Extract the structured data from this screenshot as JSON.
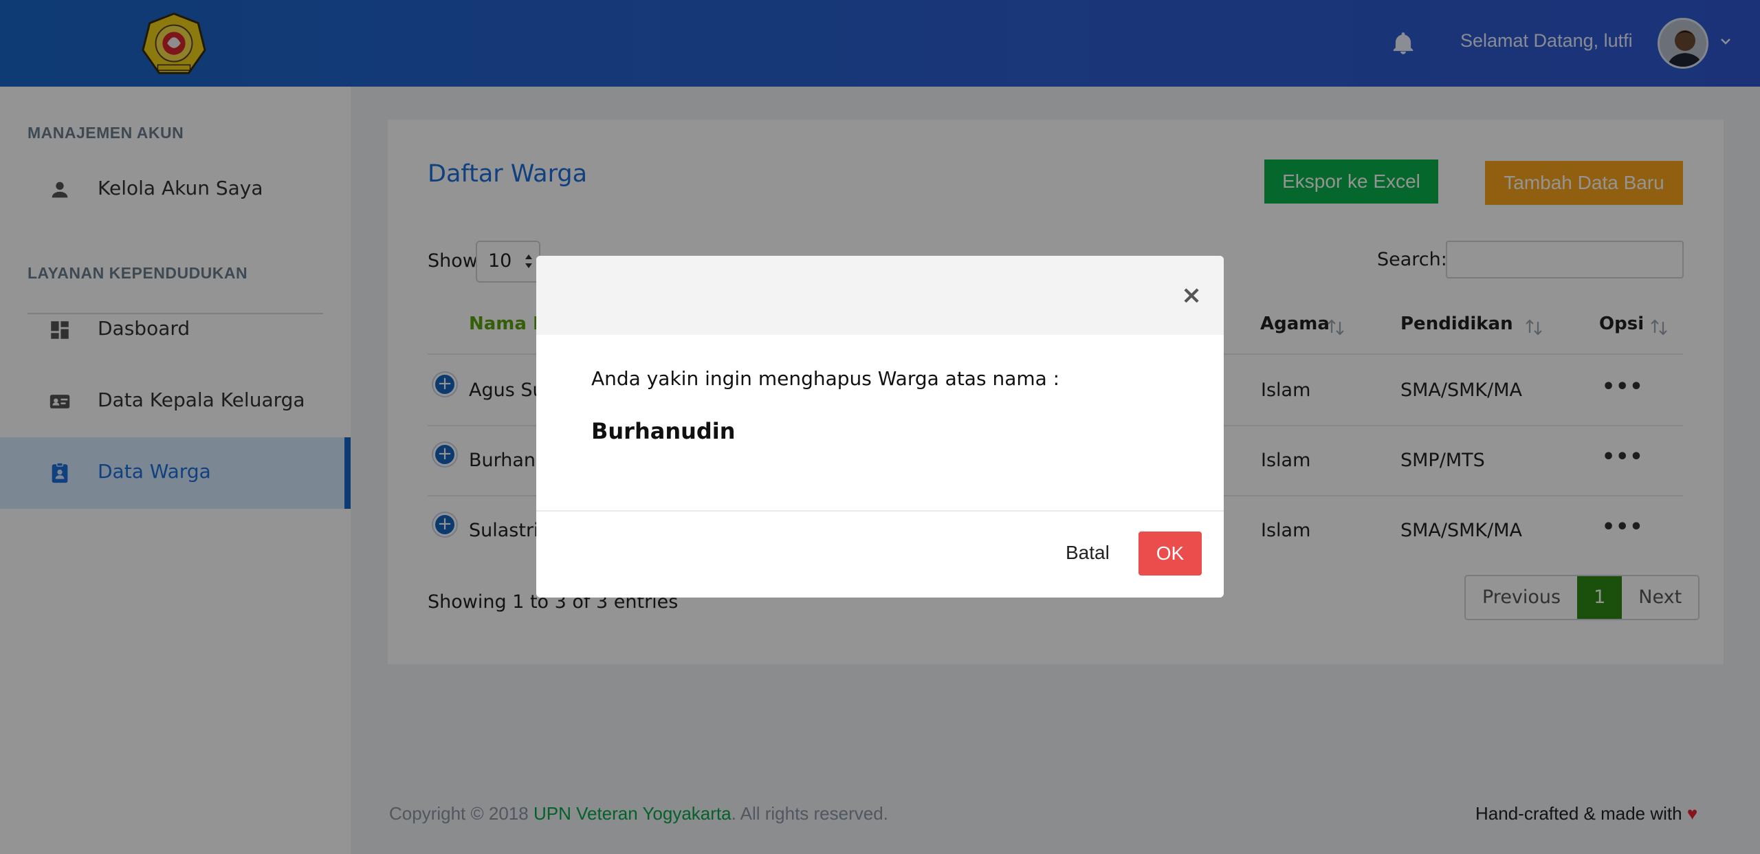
{
  "header": {
    "welcome": "Selamat Datang, lutfi",
    "icons": [
      "bell-icon",
      "chevron-down-icon"
    ]
  },
  "sidebar": {
    "section_account": "MANAJEMEN AKUN",
    "section_services": "LAYANAN KEPENDUDUKAN",
    "items": [
      {
        "label": "Kelola Akun Saya",
        "icon": "person-icon"
      },
      {
        "label": "Dasboard",
        "icon": "dashboard-icon"
      },
      {
        "label": "Data Kepala Keluarga",
        "icon": "id-card-icon"
      },
      {
        "label": "Data Warga",
        "icon": "clipboard-user-icon"
      }
    ],
    "active_item": "Data Warga"
  },
  "main": {
    "title": "Daftar Warga",
    "export_label": "Ekspor ke Excel",
    "add_label": "Tambah Data Baru",
    "show_label": "Show",
    "show_value": "10",
    "search_label": "Search:",
    "search_value": "",
    "columns": [
      "Nama Le",
      "Agama",
      "Pendidikan",
      "Opsi"
    ],
    "rows": [
      {
        "name": "Agus Sus",
        "agama": "Islam",
        "pendidikan": "SMA/SMK/MA"
      },
      {
        "name": "Burhanu",
        "agama": "Islam",
        "pendidikan": "SMP/MTS"
      },
      {
        "name": "Sulastri",
        "agama": "Islam",
        "pendidikan": "SMA/SMK/MA"
      }
    ],
    "row_options_icon": "more-horizontal-icon",
    "info": "Showing 1 to 3 of 3 entries",
    "pager": {
      "previous": "Previous",
      "current": "1",
      "next": "Next"
    }
  },
  "footer": {
    "copyright_prefix": "Copyright © 2018 ",
    "brand": "UPN Veteran Yogyakarta",
    "copyright_suffix": ". All rights reserved.",
    "right_text": "Hand-crafted & made with ",
    "heart": "♥"
  },
  "modal": {
    "close": "×",
    "message": "Anda yakin ingin menghapus Warga atas nama :",
    "name": "Burhanudin",
    "cancel_label": "Batal",
    "ok_label": "OK"
  },
  "colors": {
    "header": "#1a66c8",
    "excel": "#0ab14b",
    "add": "#f8a41a",
    "ok": "#eb4d4d",
    "active_page": "#2e8b14"
  }
}
